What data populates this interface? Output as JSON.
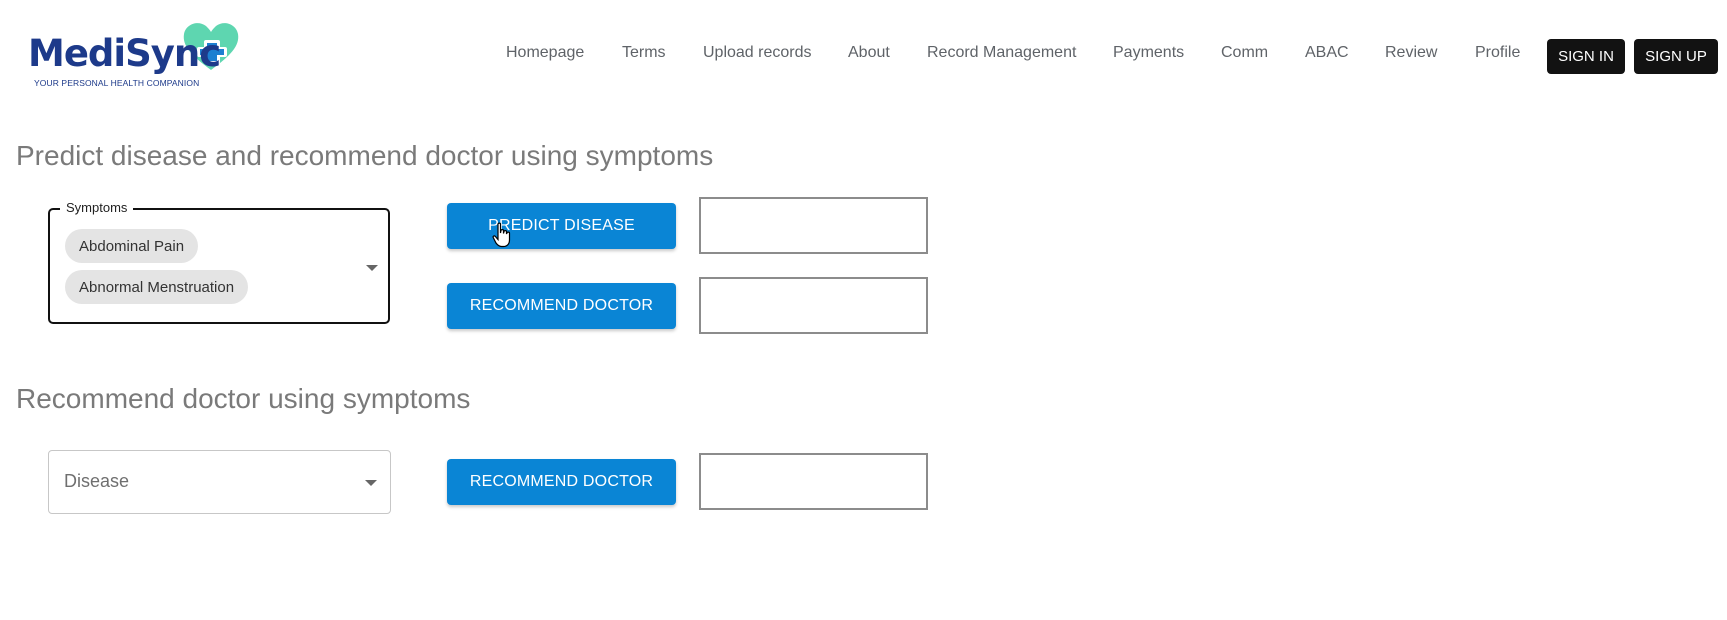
{
  "brand": {
    "name": "MediSync",
    "tagline": "YOUR PERSONAL HEALTH COMPANION",
    "text_color": "#1d3a8a",
    "heart_color": "#5ed6b0",
    "icon": "heart-cross-icon"
  },
  "nav": {
    "items": [
      "Homepage",
      "Terms",
      "Upload records",
      "About",
      "Record Management",
      "Payments",
      "Comm",
      "ABAC",
      "Review",
      "Profile"
    ],
    "sign_in": "SIGN IN",
    "sign_up": "SIGN UP"
  },
  "predict_section": {
    "title": "Predict disease and recommend doctor using symptoms",
    "symptoms_label": "Symptoms",
    "chips": [
      "Abdominal Pain",
      "Abnormal Menstruation"
    ],
    "predict_button": "PREDICT DISEASE",
    "recommend_button": "RECOMMEND DOCTOR",
    "predict_result": "",
    "recommend_result": ""
  },
  "recommend_section": {
    "title": "Recommend doctor using symptoms",
    "disease_placeholder": "Disease",
    "recommend_button": "RECOMMEND DOCTOR",
    "recommend_result": ""
  },
  "colors": {
    "primary_button": "#0a85d5",
    "dark_button": "#121212",
    "title_gray": "#7a7a7a"
  }
}
